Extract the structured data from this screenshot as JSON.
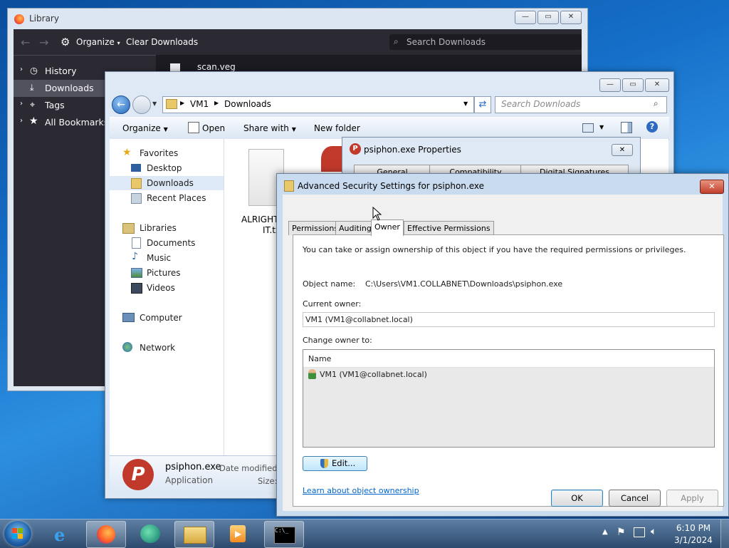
{
  "firefox": {
    "title": "Library",
    "organize": "Organize",
    "clear_downloads": "Clear Downloads",
    "search_placeholder": "Search Downloads",
    "sidebar": [
      {
        "label": "History"
      },
      {
        "label": "Downloads"
      },
      {
        "label": "Tags"
      },
      {
        "label": "All Bookmarks"
      }
    ],
    "download_item": "scan.veg"
  },
  "explorer": {
    "breadcrumb": [
      "VM1",
      "Downloads"
    ],
    "search_placeholder": "Search Downloads",
    "toolbar": {
      "organize": "Organize",
      "open": "Open",
      "share_with": "Share with",
      "new_folder": "New folder"
    },
    "nav": {
      "favorites": "Favorites",
      "desktop": "Desktop",
      "downloads": "Downloads",
      "recent_places": "Recent Places",
      "libraries": "Libraries",
      "documents": "Documents",
      "music": "Music",
      "pictures": "Pictures",
      "videos": "Videos",
      "computer": "Computer",
      "network": "Network"
    },
    "file_label_1": "ALRIGHT",
    "file_label_2": "IT.tx",
    "details": {
      "name": "psiphon.exe",
      "type": "Application",
      "date_label": "Date modified:",
      "size_label": "Size:"
    }
  },
  "properties": {
    "title": "psiphon.exe Properties",
    "tabs": [
      "General",
      "Compatibility",
      "Digital Signatures"
    ]
  },
  "advanced": {
    "title": "Advanced Security Settings for psiphon.exe",
    "tabs": [
      "Permissions",
      "Auditing",
      "Owner",
      "Effective Permissions"
    ],
    "intro": "You can take or assign ownership of this object if you have the required permissions or privileges.",
    "object_name_label": "Object name:",
    "object_name": "C:\\Users\\VM1.COLLABNET\\Downloads\\psiphon.exe",
    "current_owner_label": "Current owner:",
    "current_owner": "VM1 (VM1@collabnet.local)",
    "change_owner_label": "Change owner to:",
    "list_header": "Name",
    "list_items": [
      "VM1 (VM1@collabnet.local)"
    ],
    "edit_button": "Edit...",
    "learn_link": "Learn about object ownership",
    "ok": "OK",
    "cancel": "Cancel",
    "apply": "Apply"
  },
  "taskbar": {
    "time": "6:10 PM",
    "date": "3/1/2024"
  },
  "colors": {
    "accent": "#1f5fbf",
    "link": "#0066cc",
    "dark_ui": "#2b2a33"
  }
}
